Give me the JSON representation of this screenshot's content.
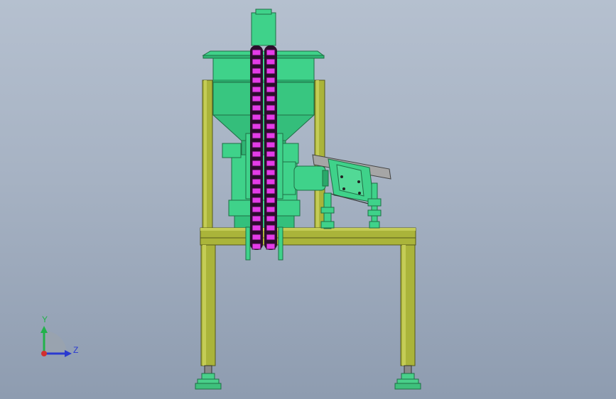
{
  "viewport": {
    "background_top": "#b5c0cf",
    "background_bottom": "#8e9cb0"
  },
  "model": {
    "colors": {
      "frame": "#aab43a",
      "frame_dark": "#6f7620",
      "body": "#3fd28a",
      "body_dark": "#1f8e55",
      "chain": "#e43ce8",
      "chain_dark": "#3a103a",
      "chute": "#a6a6a6",
      "foot": "#49d08a"
    }
  },
  "triad": {
    "y_label": "Y",
    "z_label": "Z",
    "y_color": "#22b24a",
    "z_color": "#2a3ad0",
    "x_color": "#d23030"
  }
}
